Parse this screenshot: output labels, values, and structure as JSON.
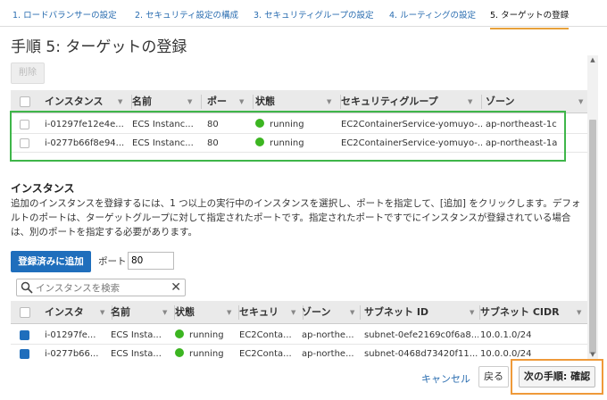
{
  "wizard": {
    "steps": [
      "1. ロードバランサーの設定",
      "2. セキュリティ設定の構成",
      "3. セキュリティグループの設定",
      "4. ルーティングの設定",
      "5. ターゲットの登録"
    ],
    "active_step": 4,
    "title": "手順 5: ターゲットの登録"
  },
  "registered": {
    "delete_label": "削除",
    "columns": [
      "インスタンス",
      "名前",
      "ポー",
      "状態",
      "セキュリティグループ",
      "ゾーン"
    ],
    "rows": [
      {
        "instance": "i-01297fe12e4e...",
        "name": "ECS Instanc...",
        "port": "80",
        "state": "running",
        "sg": "EC2ContainerService-yomuyo-...",
        "zone": "ap-northeast-1c"
      },
      {
        "instance": "i-0277b66f8e94...",
        "name": "ECS Instanc...",
        "port": "80",
        "state": "running",
        "sg": "EC2ContainerService-yomuyo-...",
        "zone": "ap-northeast-1a"
      }
    ]
  },
  "instances": {
    "heading": "インスタンス",
    "description": "追加のインスタンスを登録するには、1 つ以上の実行中のインスタンスを選択し、ポートを指定して、[追加] をクリックします。デフォルトのポートは、ターゲットグループに対して指定されたポートです。指定されたポートですでにインスタンスが登録されている場合は、別のポートを指定する必要があります。",
    "add_button": "登録済みに追加",
    "port_label": "ポート",
    "port_value": "80",
    "search_placeholder": "インスタンスを検索",
    "columns": [
      "インスタ",
      "名前",
      "状態",
      "セキュリ",
      "ゾーン",
      "サブネット ID",
      "サブネット CIDR"
    ],
    "rows": [
      {
        "instance": "i-01297fe...",
        "name": "ECS Insta...",
        "state": "running",
        "sg": "EC2Conta...",
        "zone": "ap-northe...",
        "subnet": "subnet-0efe2169c0f6a8...",
        "cidr": "10.0.1.0/24"
      },
      {
        "instance": "i-0277b66...",
        "name": "ECS Insta...",
        "state": "running",
        "sg": "EC2Conta...",
        "zone": "ap-northe...",
        "subnet": "subnet-0468d73420f11...",
        "cidr": "10.0.0.0/24"
      }
    ]
  },
  "footer": {
    "cancel_label": "キャンセル",
    "back_label": "戻る",
    "next_label": "次の手順: 確認"
  },
  "colors": {
    "primary": "#1f6ebc",
    "running": "#3cb521",
    "highlight_green": "#3fb64a",
    "highlight_orange": "#ef9a3a",
    "active_tab": "#e7a13a"
  }
}
